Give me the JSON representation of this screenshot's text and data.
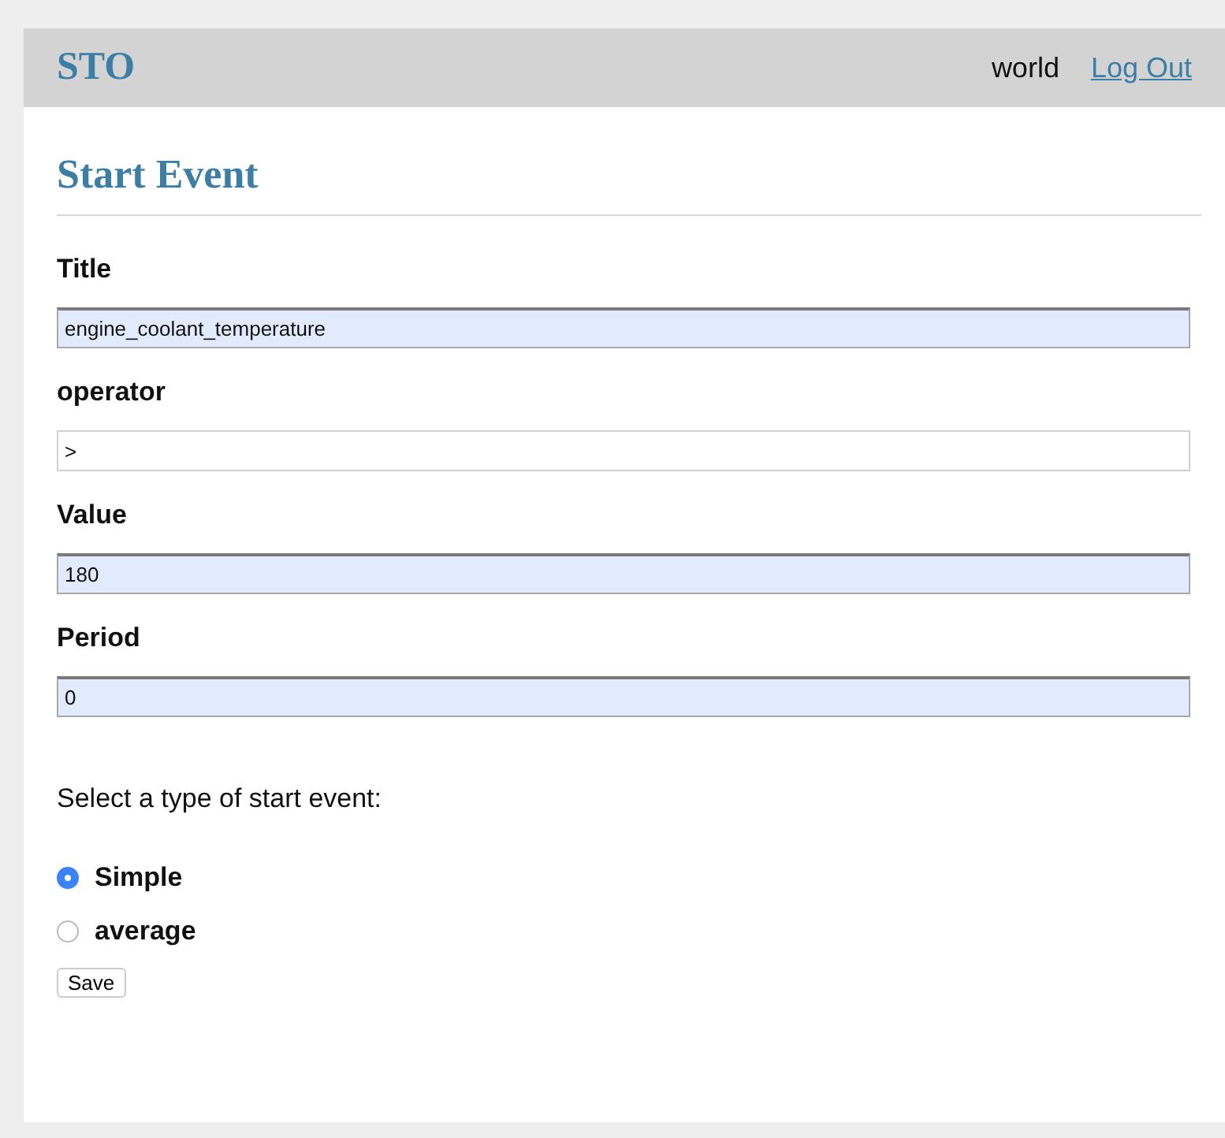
{
  "header": {
    "brand": "STO",
    "user": "world",
    "logout_link": "Log Out"
  },
  "page_title": "Start Event",
  "fields": [
    {
      "label": "Title",
      "value": "engine_coolant_temperature",
      "autofilled": true
    },
    {
      "label": "operator",
      "value": ">",
      "autofilled": false
    },
    {
      "label": "Value",
      "value": "180",
      "autofilled": true
    },
    {
      "label": "Period",
      "value": "0",
      "autofilled": true
    }
  ],
  "type_prompt": "Select a type of start event:",
  "radios": [
    {
      "label": "Simple",
      "selected": true
    },
    {
      "label": "average",
      "selected": false
    }
  ],
  "save_button": "Save"
}
